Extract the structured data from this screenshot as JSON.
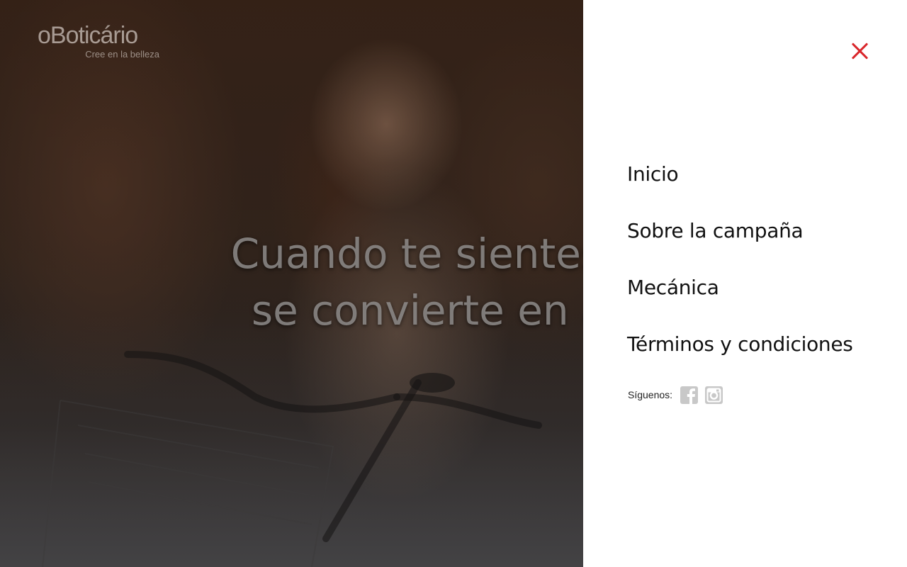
{
  "brand": {
    "logo_text": "oBoticário",
    "tagline": "Cree en la belleza"
  },
  "hero": {
    "headline_line1": "Cuando te sientes lind",
    "headline_line2": "se convierte en algo"
  },
  "menu": {
    "items": [
      {
        "label": "Inicio"
      },
      {
        "label": "Sobre la campaña"
      },
      {
        "label": "Mecánica"
      },
      {
        "label": "Términos y condiciones"
      }
    ],
    "close_icon": "close-icon",
    "accent_color": "#d9262b"
  },
  "social": {
    "label": "Síguenos:",
    "networks": [
      "facebook-icon",
      "instagram-icon"
    ],
    "icon_color": "#c8c8c8"
  }
}
